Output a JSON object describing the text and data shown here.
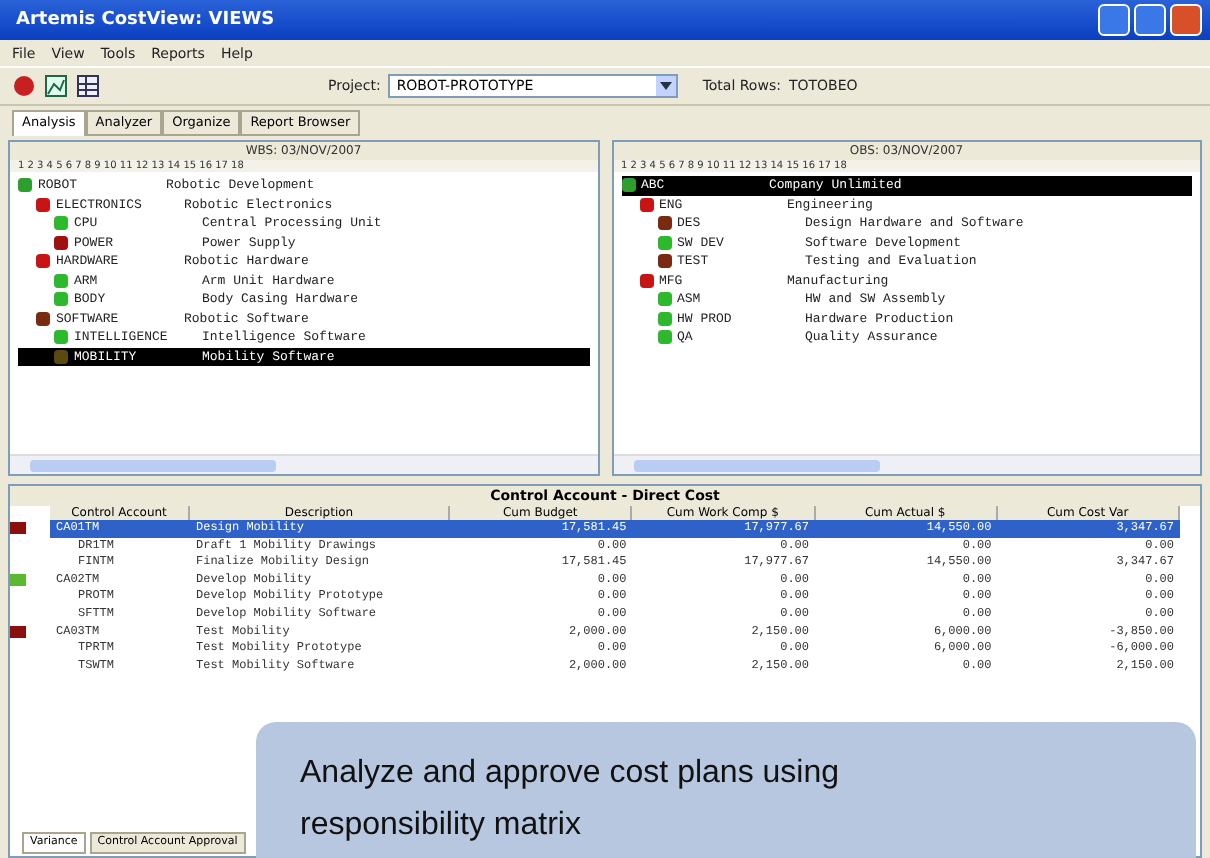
{
  "window": {
    "title": "Artemis CostView: VIEWS"
  },
  "menu": [
    "File",
    "View",
    "Tools",
    "Reports",
    "Help"
  ],
  "toolbar": {
    "project_label": "Project:",
    "project_value": "ROBOT-PROTOTYPE",
    "rows_label": "Total Rows:",
    "rows_value": "TOTOBEO"
  },
  "tabs": [
    {
      "label": "Analysis",
      "selected": true
    },
    {
      "label": "Analyzer",
      "selected": false
    },
    {
      "label": "Organize",
      "selected": false
    },
    {
      "label": "Report Browser",
      "selected": false
    }
  ],
  "panes": [
    {
      "header": "WBS: 03/NOV/2007",
      "ruler": "1 2 3 4 5 6 7 8 9 10 11 12 13 14 15 16 17 18",
      "tree": [
        {
          "code": "ROBOT",
          "description": "Robotic Development",
          "color": "#2e9e2e",
          "selected": false,
          "children": [
            {
              "code": "ELECTRONICS",
              "description": "Robotic Electronics",
              "color": "#c81414",
              "selected": false,
              "children": [
                {
                  "code": "CPU",
                  "description": "Central Processing Unit",
                  "color": "#2eb82e",
                  "selected": false
                },
                {
                  "code": "POWER",
                  "description": "Power Supply",
                  "color": "#a01010",
                  "selected": false
                }
              ]
            },
            {
              "code": "HARDWARE",
              "description": "Robotic Hardware",
              "color": "#c81414",
              "selected": false,
              "children": [
                {
                  "code": "ARM",
                  "description": "Arm Unit Hardware",
                  "color": "#2eb82e",
                  "selected": false
                },
                {
                  "code": "BODY",
                  "description": "Body Casing Hardware",
                  "color": "#2eb82e",
                  "selected": false
                }
              ]
            },
            {
              "code": "SOFTWARE",
              "description": "Robotic Software",
              "color": "#7a2a10",
              "selected": false,
              "children": [
                {
                  "code": "INTELLIGENCE",
                  "description": "Intelligence Software",
                  "color": "#2eb82e",
                  "selected": false
                },
                {
                  "code": "MOBILITY",
                  "description": "Mobility Software",
                  "color": "#5a4a10",
                  "selected": true
                }
              ]
            }
          ]
        }
      ]
    },
    {
      "header": "OBS: 03/NOV/2007",
      "ruler": "1 2 3 4 5 6 7 8 9 10 11 12 13 14 15 16 17 18",
      "tree": [
        {
          "code": "ABC",
          "description": "Company Unlimited",
          "color": "#2e9e2e",
          "selected": true,
          "children": [
            {
              "code": "ENG",
              "description": "Engineering",
              "color": "#c81414",
              "selected": false,
              "children": [
                {
                  "code": "DES",
                  "description": "Design Hardware and Software",
                  "color": "#7a2a10",
                  "selected": false
                },
                {
                  "code": "SW DEV",
                  "description": "Software Development",
                  "color": "#2eb82e",
                  "selected": false
                },
                {
                  "code": "TEST",
                  "description": "Testing and Evaluation",
                  "color": "#7a2a10",
                  "selected": false
                }
              ]
            },
            {
              "code": "MFG",
              "description": "Manufacturing",
              "color": "#c81414",
              "selected": false,
              "children": [
                {
                  "code": "ASM",
                  "description": "HW and SW Assembly",
                  "color": "#2eb82e",
                  "selected": false
                },
                {
                  "code": "HW PROD",
                  "description": "Hardware Production",
                  "color": "#2eb82e",
                  "selected": false
                },
                {
                  "code": "QA",
                  "description": "Quality Assurance",
                  "color": "#2eb82e",
                  "selected": false
                }
              ]
            }
          ]
        }
      ]
    }
  ],
  "table": {
    "title": "Control Account - Direct Cost",
    "columns": [
      "Control Account",
      "Description",
      "Cum Budget",
      "Cum Work Comp $",
      "Cum Actual $",
      "Cum Cost Var"
    ],
    "rows": [
      {
        "cells": [
          "CA01TM",
          "Design Mobility",
          "17,581.45",
          "17,977.67",
          "14,550.00",
          "3,347.67"
        ],
        "color": "#8a1010",
        "selected": true,
        "children": [
          {
            "cells": [
              "DR1TM",
              "Draft 1 Mobility Drawings",
              "0.00",
              "0.00",
              "0.00",
              "0.00"
            ],
            "selected": false
          },
          {
            "cells": [
              "FINTM",
              "Finalize Mobility Design",
              "17,581.45",
              "17,977.67",
              "14,550.00",
              "3,347.67"
            ],
            "selected": false
          }
        ]
      },
      {
        "cells": [
          "CA02TM",
          "Develop Mobility",
          "0.00",
          "0.00",
          "0.00",
          "0.00"
        ],
        "color": "#5cb82e",
        "selected": false,
        "children": [
          {
            "cells": [
              "PROTM",
              "Develop Mobility Prototype",
              "0.00",
              "0.00",
              "0.00",
              "0.00"
            ],
            "selected": false
          },
          {
            "cells": [
              "SFTTM",
              "Develop Mobility Software",
              "0.00",
              "0.00",
              "0.00",
              "0.00"
            ],
            "selected": false
          }
        ]
      },
      {
        "cells": [
          "CA03TM",
          "Test Mobility",
          "2,000.00",
          "2,150.00",
          "6,000.00",
          "-3,850.00"
        ],
        "color": "#8a1010",
        "selected": false,
        "children": [
          {
            "cells": [
              "TPRTM",
              "Test Mobility Prototype",
              "0.00",
              "0.00",
              "6,000.00",
              "-6,000.00"
            ],
            "selected": false
          },
          {
            "cells": [
              "TSWTM",
              "Test Mobility Software",
              "2,000.00",
              "2,150.00",
              "0.00",
              "2,150.00"
            ],
            "selected": false
          }
        ]
      }
    ]
  },
  "bottom_tabs": [
    {
      "label": "Variance",
      "selected": true
    },
    {
      "label": "Control Account Approval",
      "selected": false
    }
  ],
  "callout": "Analyze and approve cost plans using responsibility matrix"
}
